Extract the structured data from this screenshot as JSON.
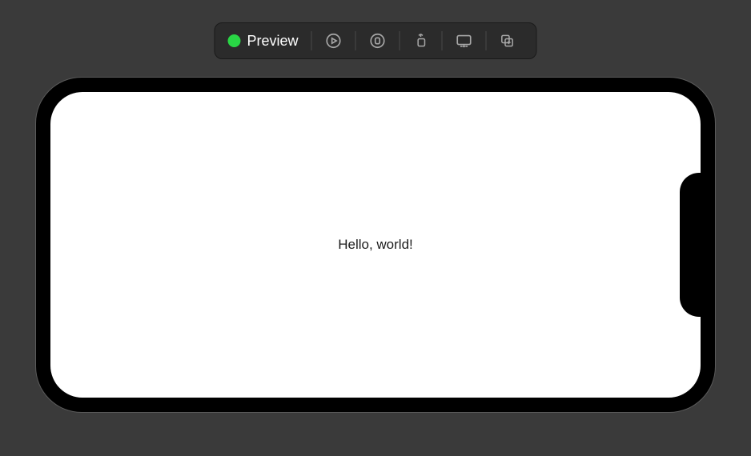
{
  "toolbar": {
    "preview_label": "Preview"
  },
  "canvas": {
    "content_text": "Hello, world!"
  }
}
